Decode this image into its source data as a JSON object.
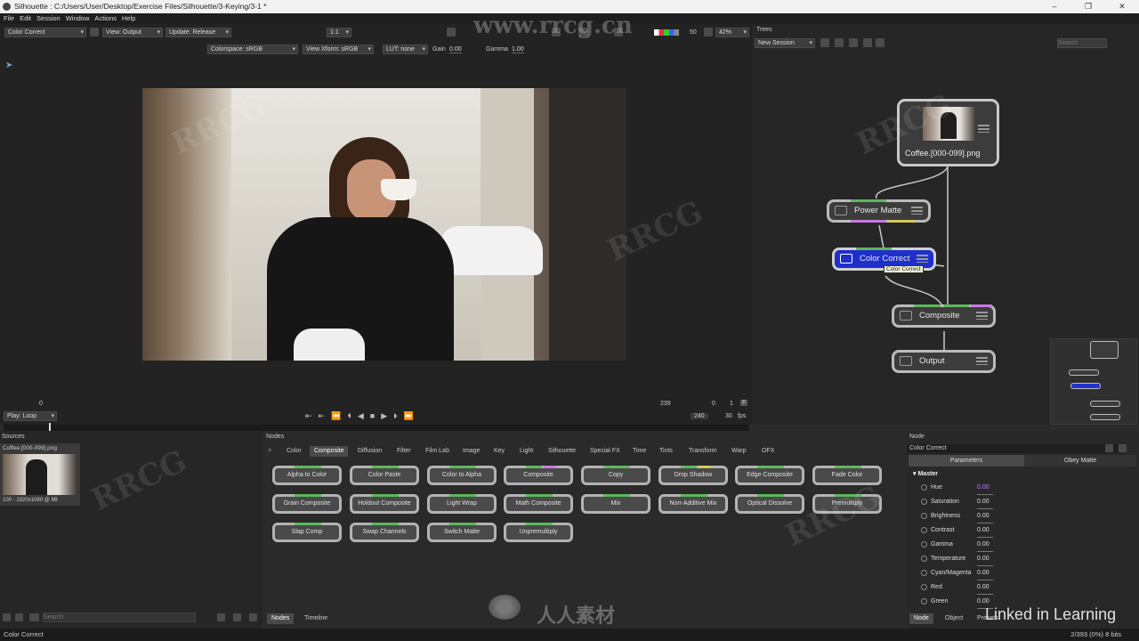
{
  "titlebar": {
    "title": "Silhouette : C:/Users/User/Desktop/Exercise Files/Silhouette/3-Keying/3-1 *"
  },
  "menu": [
    "File",
    "Edit",
    "Session",
    "Window",
    "Actions",
    "Help"
  ],
  "viewer": {
    "node_select": "Color Correct",
    "view": "View: Output",
    "update": "Update: Release",
    "ratio": "1:1",
    "colorspace": "Colorspace: sRGB",
    "view_xform": "View Xform: sRGB",
    "lut": "LUT: none",
    "gain_label": "Gain",
    "gain_value": "0.00",
    "gamma_label": "Gamma",
    "gamma_value": "1.00",
    "num50": "50",
    "zoom": "42%"
  },
  "timeline": {
    "start": "0",
    "end_marker": "239",
    "frame_current": "0",
    "frame_step": "1",
    "f_btn": "F",
    "total": "240",
    "fps_value": "30",
    "fps_label": "fps",
    "play_mode": "Play: Loop"
  },
  "trees": {
    "title": "Trees",
    "session": "New Session",
    "search_placeholder": "Search",
    "nodes": {
      "source": "Coffee.[000-099].png",
      "power_matte": "Power Matte",
      "color_correct": "Color Correct",
      "composite": "Composite",
      "output": "Output"
    },
    "tooltip": "Color Correct"
  },
  "sources": {
    "title": "Sources",
    "item_name": "Coffee.[000-099].png",
    "item_info": "100 - 1920x1080 @ 8B",
    "search_placeholder": "Search"
  },
  "nodes_panel": {
    "title": "Nodes",
    "categories": [
      "Color",
      "Composite",
      "Diffusion",
      "Filter",
      "Film Lab",
      "Image",
      "Key",
      "Light",
      "Silhouette",
      "Special FX",
      "Time",
      "Tints",
      "Transform",
      "Warp",
      "OFX"
    ],
    "active_category": "Composite",
    "buttons_row1": [
      "Alpha to Color",
      "Color Paste",
      "Color to Alpha",
      "Composite",
      "Copy",
      "Drop Shadow",
      "Edge Composite",
      "Fade Color"
    ],
    "buttons_row2": [
      "Grain Composite",
      "Holdout Composite",
      "Light Wrap",
      "Math Composite",
      "Mix",
      "Non-Additive Mix",
      "Optical Dissolve",
      "Premultiply"
    ],
    "buttons_row3": [
      "Slap Comp",
      "Swap Channels",
      "Switch Matte",
      "Unpremultiply"
    ],
    "bottom_tabs": [
      "Nodes",
      "Timeline"
    ]
  },
  "node_params": {
    "title": "Node",
    "node_name": "Color Correct",
    "tabs": [
      "Parameters",
      "Obey Matte"
    ],
    "section": "Master",
    "params": [
      {
        "name": "Hue",
        "value": "0.00"
      },
      {
        "name": "Saturation",
        "value": "0.00"
      },
      {
        "name": "Brightness",
        "value": "0.00"
      },
      {
        "name": "Contrast",
        "value": "0.00"
      },
      {
        "name": "Gamma",
        "value": "0.00"
      },
      {
        "name": "Temperature",
        "value": "0.00"
      },
      {
        "name": "Cyan/Magenta",
        "value": "0.00"
      },
      {
        "name": "Red",
        "value": "0.00"
      },
      {
        "name": "Green",
        "value": "0.00"
      }
    ],
    "bottom_tabs": [
      "Node",
      "Object",
      "Presets"
    ]
  },
  "status": {
    "left": "Color Correct",
    "right": "2/393 (0%) 8 bits"
  },
  "watermarks": {
    "site": "www.rrcg.cn",
    "brand": "Linked in Learning",
    "rrcg": "RRCG",
    "cn": "人人素材"
  }
}
